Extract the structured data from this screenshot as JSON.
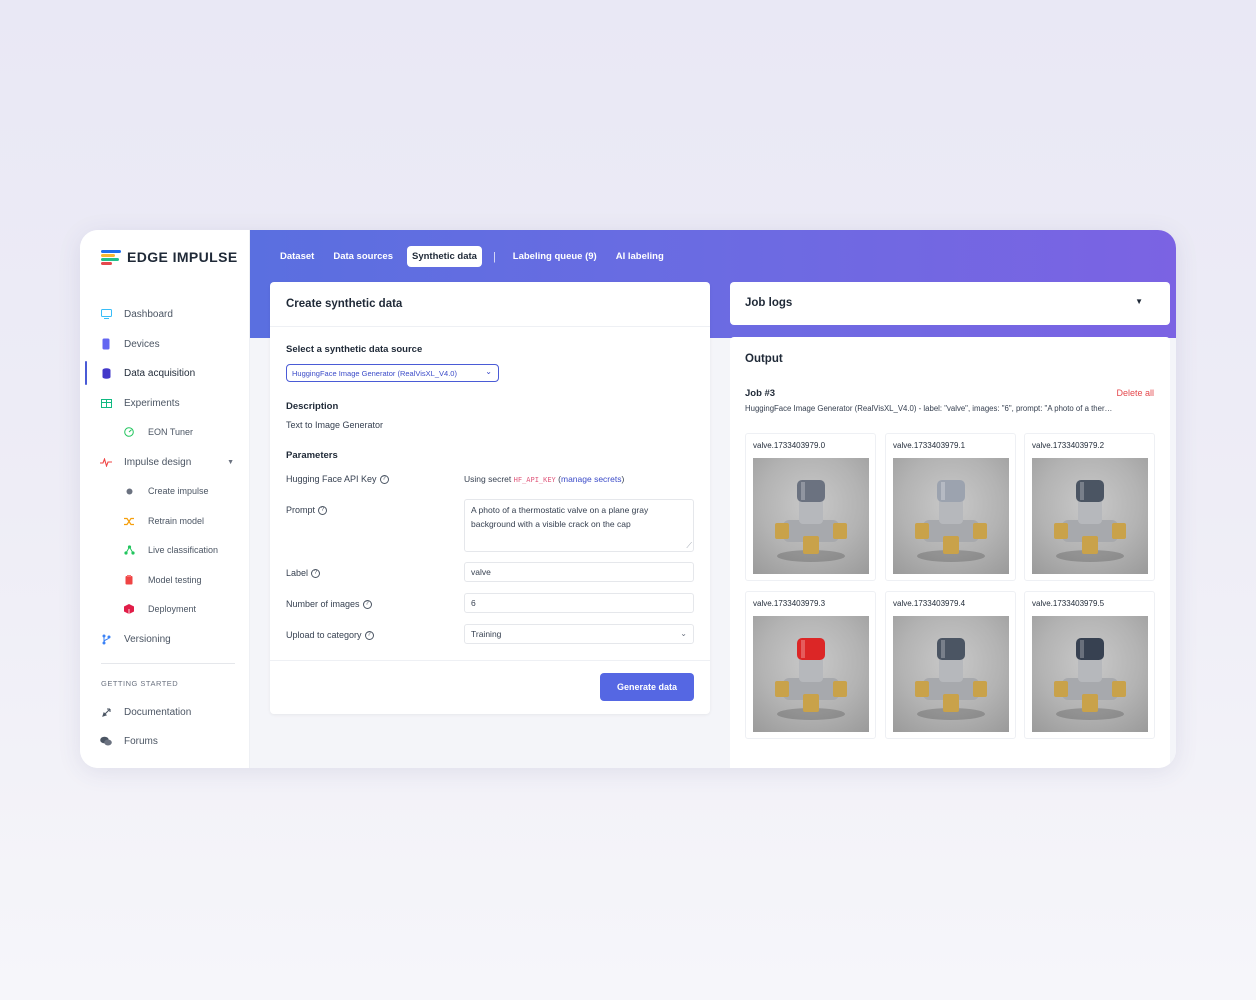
{
  "brand": {
    "name": "EDGE IMPULSE",
    "colors": [
      "#1f6feb",
      "#f7b733",
      "#21c08b",
      "#e5484d"
    ]
  },
  "sidebar": {
    "items": [
      {
        "label": "Dashboard",
        "icon": "monitor-icon",
        "color": "#38bdf8"
      },
      {
        "label": "Devices",
        "icon": "device-icon",
        "color": "#6366f1"
      },
      {
        "label": "Data acquisition",
        "icon": "database-icon",
        "color": "#4338ca",
        "active": true
      },
      {
        "label": "Experiments",
        "icon": "table-icon",
        "color": "#10b981"
      },
      {
        "label": "EON Tuner",
        "icon": "gauge-icon",
        "color": "#22c55e",
        "sub": true
      },
      {
        "label": "Impulse design",
        "icon": "pulse-icon",
        "color": "#ef4444",
        "expandable": true
      },
      {
        "label": "Create impulse",
        "icon": "dot-icon",
        "color": "#6b7280",
        "sub": true
      },
      {
        "label": "Retrain model",
        "icon": "shuffle-icon",
        "color": "#f59e0b",
        "sub": true
      },
      {
        "label": "Live classification",
        "icon": "nodes-icon",
        "color": "#22c55e",
        "sub": true
      },
      {
        "label": "Model testing",
        "icon": "clipboard-icon",
        "color": "#ef4444",
        "sub": true
      },
      {
        "label": "Deployment",
        "icon": "box-icon",
        "color": "#e11d48",
        "sub": true
      },
      {
        "label": "Versioning",
        "icon": "branch-icon",
        "color": "#3b82f6"
      }
    ],
    "section": "GETTING STARTED",
    "getting_started": [
      {
        "label": "Documentation",
        "icon": "rocket-icon"
      },
      {
        "label": "Forums",
        "icon": "chat-icon"
      }
    ]
  },
  "tabs": [
    {
      "label": "Dataset"
    },
    {
      "label": "Data sources"
    },
    {
      "label": "Synthetic data",
      "active": true
    },
    {
      "label": "Labeling queue (9)"
    },
    {
      "label": "AI labeling"
    }
  ],
  "create": {
    "title": "Create synthetic data",
    "source_label": "Select a synthetic data source",
    "source_value": "HuggingFace Image Generator (RealVisXL_V4.0)",
    "description_label": "Description",
    "description_value": "Text to Image Generator",
    "parameters_label": "Parameters",
    "api_key_label": "Hugging Face API Key",
    "api_key_prefix": "Using secret",
    "api_key_secret": "HF_API_KEY",
    "api_key_link": "manage secrets",
    "prompt_label": "Prompt",
    "prompt_value": "A photo of a thermostatic valve on a plane gray background with a visible crack on the cap",
    "label_label": "Label",
    "label_value": "valve",
    "num_images_label": "Number of images",
    "num_images_value": "6",
    "category_label": "Upload to category",
    "category_value": "Training",
    "generate_button": "Generate data"
  },
  "joblogs": {
    "title": "Job logs"
  },
  "output": {
    "title": "Output",
    "job_title": "Job #3",
    "delete_all": "Delete all",
    "job_desc": "HuggingFace Image Generator (RealVisXL_V4.0) - label: \"valve\", images: \"6\", prompt: \"A photo of a ther…",
    "images": [
      {
        "name": "valve.1733403979.0",
        "cap": "#6b7280"
      },
      {
        "name": "valve.1733403979.1",
        "cap": "#9ca3af"
      },
      {
        "name": "valve.1733403979.2",
        "cap": "#4b5563"
      },
      {
        "name": "valve.1733403979.3",
        "cap": "#dc2626"
      },
      {
        "name": "valve.1733403979.4",
        "cap": "#4b5563"
      },
      {
        "name": "valve.1733403979.5",
        "cap": "#374151"
      }
    ]
  }
}
